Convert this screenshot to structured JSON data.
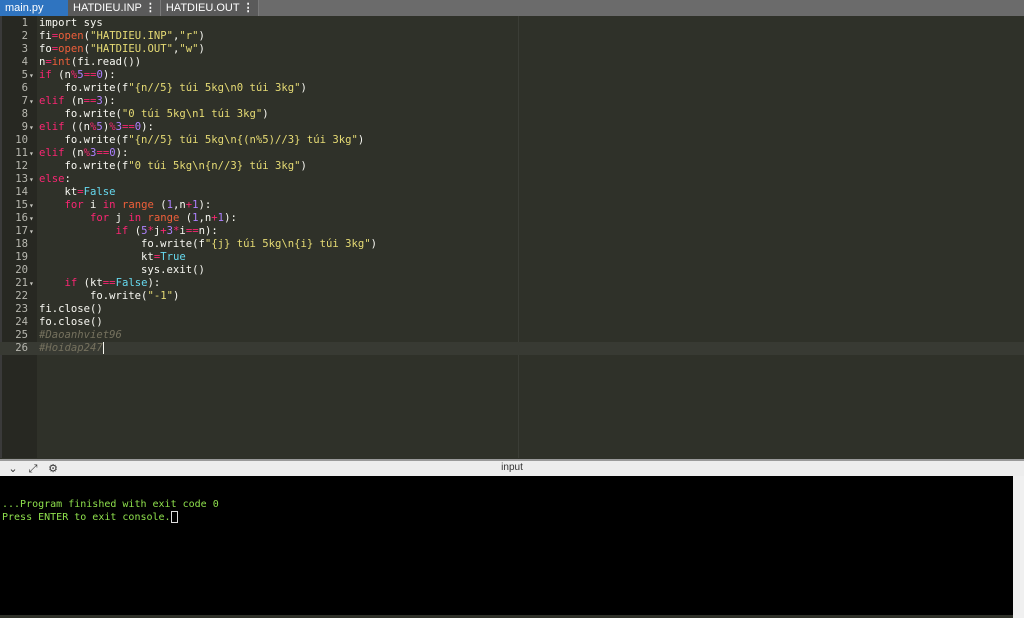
{
  "tabs": [
    {
      "label": "main.py",
      "active": true
    },
    {
      "label": "HATDIEU.INP",
      "active": false
    },
    {
      "label": "HATDIEU.OUT",
      "active": false
    }
  ],
  "editor": {
    "active_line": 26,
    "lines": [
      {
        "n": "1",
        "fold": false
      },
      {
        "n": "2",
        "fold": false
      },
      {
        "n": "3",
        "fold": false
      },
      {
        "n": "4",
        "fold": false
      },
      {
        "n": "5",
        "fold": true
      },
      {
        "n": "6",
        "fold": false
      },
      {
        "n": "7",
        "fold": true
      },
      {
        "n": "8",
        "fold": false
      },
      {
        "n": "9",
        "fold": true
      },
      {
        "n": "10",
        "fold": false
      },
      {
        "n": "11",
        "fold": true
      },
      {
        "n": "12",
        "fold": false
      },
      {
        "n": "13",
        "fold": true
      },
      {
        "n": "14",
        "fold": false
      },
      {
        "n": "15",
        "fold": true
      },
      {
        "n": "16",
        "fold": true
      },
      {
        "n": "17",
        "fold": true
      },
      {
        "n": "18",
        "fold": false
      },
      {
        "n": "19",
        "fold": false
      },
      {
        "n": "20",
        "fold": false
      },
      {
        "n": "21",
        "fold": true
      },
      {
        "n": "22",
        "fold": false
      },
      {
        "n": "23",
        "fold": false
      },
      {
        "n": "24",
        "fold": false
      },
      {
        "n": "25",
        "fold": false
      },
      {
        "n": "26",
        "fold": false
      }
    ],
    "code": {
      "l1": [
        "import sys"
      ],
      "l2": [
        "fi",
        "=",
        "open",
        "(",
        "\"HATDIEU.INP\"",
        ",",
        "\"r\"",
        ")"
      ],
      "l3": [
        "fo",
        "=",
        "open",
        "(",
        "\"HATDIEU.OUT\"",
        ",",
        "\"w\"",
        ")"
      ],
      "l4": [
        "n",
        "=",
        "int",
        "(fi.read())"
      ],
      "l5": [
        "if",
        " (n",
        "%",
        "5",
        "==",
        "0",
        "):"
      ],
      "l6": [
        "    fo.write(f",
        "\"{n//5} túi 5kg\\n0 túi 3kg\"",
        ")"
      ],
      "l7": [
        "elif",
        " (n",
        "==",
        "3",
        "):"
      ],
      "l8": [
        "    fo.write(",
        "\"0 túi 5kg\\n1 túi 3kg\"",
        ")"
      ],
      "l9": [
        "elif",
        " ((n",
        "%",
        "5",
        ")",
        "%",
        "3",
        "==",
        "0",
        "):"
      ],
      "l10": [
        "    fo.write(f",
        "\"{n//5} túi 5kg\\n{(n%5)//3} túi 3kg\"",
        ")"
      ],
      "l11": [
        "elif",
        " (n",
        "%",
        "3",
        "==",
        "0",
        "):"
      ],
      "l12": [
        "    fo.write(f",
        "\"0 túi 5kg\\n{n//3} túi 3kg\"",
        ")"
      ],
      "l13": [
        "else",
        ":"
      ],
      "l14": [
        "    kt",
        "=",
        "False"
      ],
      "l15": [
        "    ",
        "for",
        " i ",
        "in",
        " ",
        "range",
        " (",
        "1",
        ",n",
        "+",
        "1",
        "):"
      ],
      "l16": [
        "        ",
        "for",
        " j ",
        "in",
        " ",
        "range",
        " (",
        "1",
        ",n",
        "+",
        "1",
        "):"
      ],
      "l17": [
        "            ",
        "if",
        " (",
        "5",
        "*",
        "j",
        "+",
        "3",
        "*",
        "i",
        "==",
        "n):"
      ],
      "l18": [
        "                fo.write(f",
        "\"{j} túi 5kg\\n{i} túi 3kg\"",
        ")"
      ],
      "l19": [
        "                kt",
        "=",
        "True"
      ],
      "l20": [
        "                sys.exit()"
      ],
      "l21": [
        "    ",
        "if",
        " (kt",
        "==",
        "False",
        "):"
      ],
      "l22": [
        "        fo.write(",
        "\"-1\"",
        ")"
      ],
      "l23": [
        "fi.close()"
      ],
      "l24": [
        "fo.close()"
      ],
      "l25": [
        "#Daoanhviet96"
      ],
      "l26": [
        "#Hoidap247"
      ]
    }
  },
  "console": {
    "title": "input",
    "lines": [
      "...Program finished with exit code 0",
      "Press ENTER to exit console."
    ]
  }
}
